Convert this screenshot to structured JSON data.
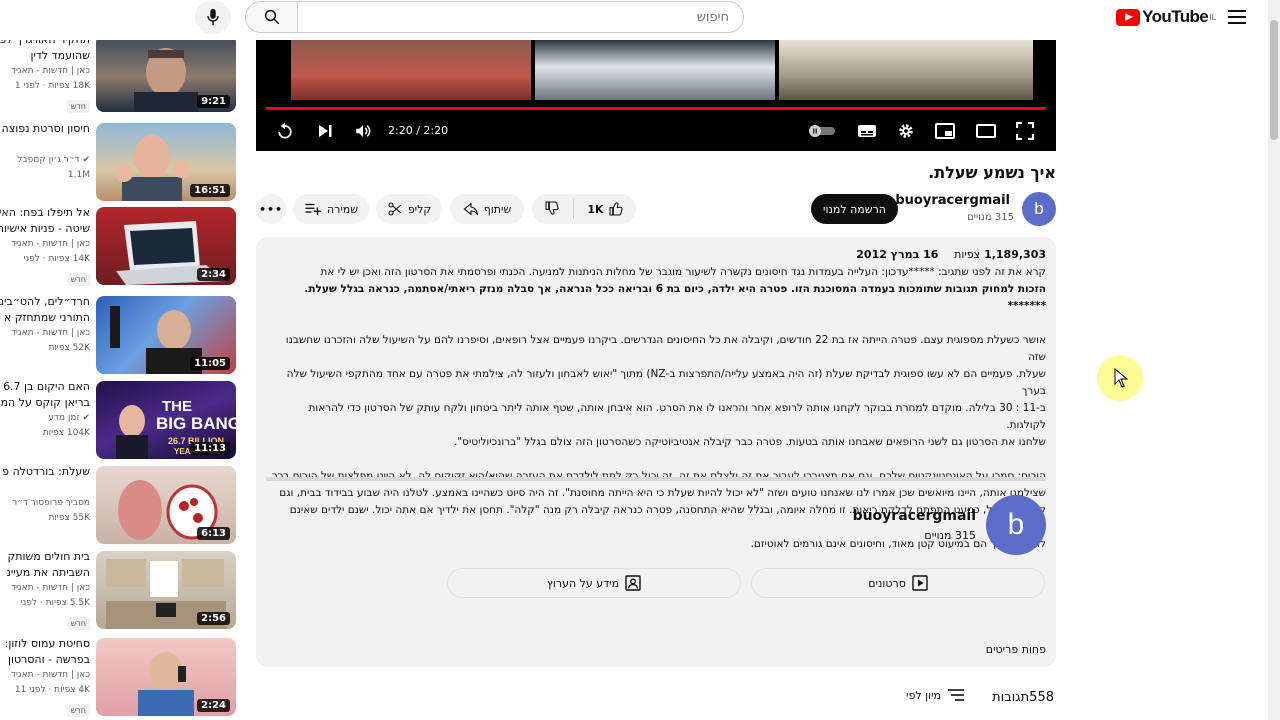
{
  "header": {
    "logo_text": "YouTube",
    "logo_sup": "IL",
    "search_placeholder": "חיפוש"
  },
  "sidebar": {
    "items": [
      {
        "title": "תחקיר האוויגרך לפוטין שהועמד לדין",
        "channel": "כאן | חדשות - תאגיד",
        "views": "18K צפיות · לפני 1",
        "badge": "חדש",
        "duration": "9:21"
      },
      {
        "title": "חיסון וסרטת נפוצה",
        "channel": "ד״ר ג׳ון קמפבל",
        "views": "1.1M",
        "badge": "",
        "duration": "16:51"
      },
      {
        "title": "אל תיפלו בפח: האי שיטה - פניות אישיות",
        "channel": "כאן | חדשות - תאגיד",
        "views": "14K צפיות · לפני",
        "badge": "חדש",
        "duration": "2:34"
      },
      {
        "title": "חרד״לים, להט״בים התורני שמתחזק א",
        "channel": "כאן | חדשות - תאגיד",
        "views": "52K צפיות",
        "badge": "",
        "duration": "11:05"
      },
      {
        "title": "האם היקום בן 6.7 בריאן קוקס על המ",
        "channel": "זמן מדע",
        "views": "104K צפיות",
        "badge": "",
        "duration": "11:13"
      },
      {
        "title": "שעלת: בורדטלה פ",
        "channel": "מסביר פרופסור ד״ר",
        "views": "55K צפיות",
        "badge": "",
        "duration": "6:13"
      },
      {
        "title": "בית חולים משותק השביתה את מעיינ",
        "channel": "כאן | חדשות - תאגיד",
        "views": "5.5K צפיות · לפני",
        "badge": "חדש",
        "duration": "2:56"
      },
      {
        "title": "סחיטת עמוס לוזון: בפרשה - והסרטון",
        "channel": "כאן | חדשות - תאגיד",
        "views": "4K צפיות · לפני 11",
        "badge": "חדש",
        "duration": "2:24"
      }
    ]
  },
  "player": {
    "time": "2:20 / 2:20",
    "progress": 1.0
  },
  "video": {
    "title": "איך נשמע שעלת.",
    "owner": "buoyracergmail",
    "owner_initial": "b",
    "subs": "315 מנויים",
    "subscribe": "הרשמה למנוי",
    "likes": "1K",
    "share": "שיתוף",
    "clip": "קליפ",
    "save": "שמירה"
  },
  "description": {
    "views": "1,189,303",
    "views_label": "צפיות",
    "date": "16 במרץ 2012",
    "p1a": "קרא את זה לפני שתגיב: *****עדכון: העלייה בעמדות נגד חיסונים נקשרה לשיעור מוגבר של מחלות הניתנות למניעה.   הכנתי ופרסמתי את הסרטון הזה ואכן יש לי את",
    "p1b": "הזכות למחוק תגובות שתומכות בעמדה המסוכנת הזו.   פטרה היא ילדה, כיום בת 6 ובריאה ככל הנראה, אך סבלה מנזק ריאתי/אסתמה, כנראה בגלל שעלת.   *******",
    "p2a": "אושר כשעלת מספוגית עצם.   פטרה הייתה אז בת 22 חודשים, וקיבלה את כל החיסונים הנדרשים.   ביקרנו פעמיים אצל רופאים, וסיפרנו להם על השיעול שלה והזכרנו שחשבנו שזה",
    "p2b": "שעלת.   פעמיים הם לא עשו ספוגית לבדיקת שעלת (זה היה באמצע עלייה/התפרצות ב-NZ) מתוך \"יאוש לאבחון ולעזור לה, צילמתי את פטרה עם אחד מהתקפי השיעול שלה בערך",
    "p2c": "ב-11 : 30 בלילה.   מוקדם למחרת בבוקר לקחנו אותה לרופא אחר והראנו לו את הסרט.   הוא איבחן אותה, שטף אותה ליתר ביטחון ולקח עותק של הסרטון כדי להראות לקולגות.",
    "p2d": "שלחנו את הסרטון גם לשני הרופאים שאבחנו אותה בטעות.   פטרה כבר קיבלה אנטיביוטיקה כשהסרטון הזה צולם בגלל \"ברונכיוליטיס\".",
    "p3a": "הורים: סמכו על האינסטינקטים שלכם, וגם אם תצטרכו לעבור את זה ולצלם את זה, זה יכול רק לתת לילדכם את העזרה שהוא/היא זקוקים לה.   לא היינו מפלצות של הורים בכך",
    "p3b": "שצילמנו אותה, היינו מיואשים שכן אמרו לנו שאנחנו טועים ושזה \"לא יכול להיות שעלת כי היא הייתה מחוסנת\".   זה היה סיוט כשהיינו באמצע.   לטלנו היה שבוע בבידוד בבית, וגם",
    "p3c": "קיבלתי שיעול, כמעט התפתח לדלקת ריאות.   זו מחלה איומה, ובגלל שהיא התחסנה, פטרה כנראה קיבלה רק מנה \"קלה\".   תחסן את ילדיך אם אתה יכול.   ישנם ילדים שאינם יכולים",
    "p3d": "להתחסן, אך הם במיעוט קטן מאוד, וחיסונים אינם גורמים לאוטיזם.",
    "channel_name": "buoyracergmail",
    "channel_subs": "315 מנויים",
    "videos_btn": "סרטונים",
    "about_btn": "מידע על הערוץ",
    "show_less": "פחות פריטים"
  },
  "comments": {
    "count": "558",
    "label": "תגובות",
    "sort": "מיון לפי"
  }
}
